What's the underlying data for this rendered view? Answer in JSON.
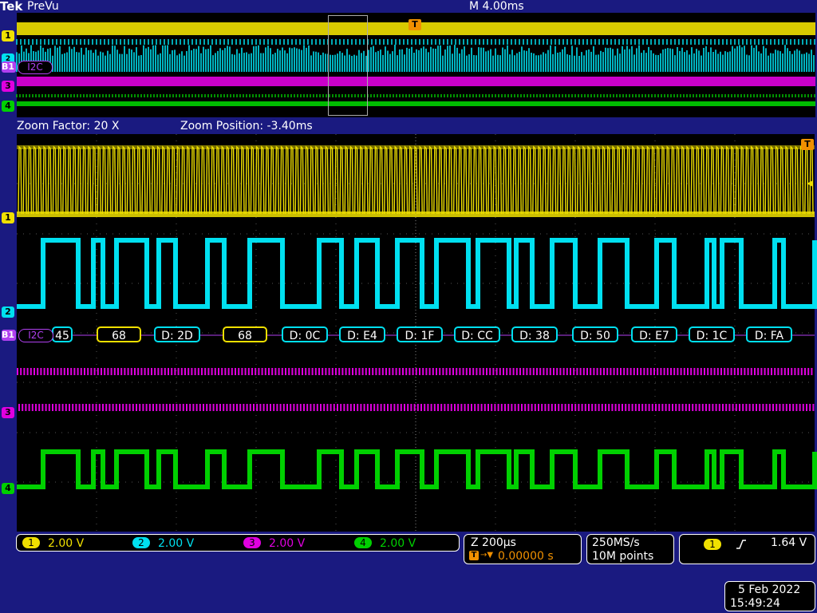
{
  "brand": "Tek",
  "mode": "PreVu",
  "timebase": "M 4.00ms",
  "zoom": {
    "factor_label": "Zoom Factor: 20 X",
    "position_label": "Zoom Position: -3.40ms"
  },
  "trigger_marker": "T",
  "bus": {
    "name": "I2C",
    "id": "B1",
    "packets": [
      {
        "text": "45",
        "kind": "data"
      },
      {
        "text": "68",
        "kind": "address"
      },
      {
        "text": "D: 2D",
        "kind": "data"
      },
      {
        "text": "68",
        "kind": "address"
      },
      {
        "text": "D: 0C",
        "kind": "data"
      },
      {
        "text": "D: E4",
        "kind": "data"
      },
      {
        "text": "D: 1F",
        "kind": "data"
      },
      {
        "text": "D: CC",
        "kind": "data"
      },
      {
        "text": "D: 38",
        "kind": "data"
      },
      {
        "text": "D: 50",
        "kind": "data"
      },
      {
        "text": "D: E7",
        "kind": "data"
      },
      {
        "text": "D: 1C",
        "kind": "data"
      },
      {
        "text": "D: FA",
        "kind": "data"
      }
    ]
  },
  "channels": [
    {
      "num": "1",
      "scale": "2.00 V",
      "color": "#f0e000"
    },
    {
      "num": "2",
      "scale": "2.00 V",
      "color": "#00e0f0"
    },
    {
      "num": "3",
      "scale": "2.00 V",
      "color": "#e000e0"
    },
    {
      "num": "4",
      "scale": "2.00 V",
      "color": "#00d000"
    }
  ],
  "horizontal": {
    "scale": "Z 200µs",
    "delay": "0.00000 s"
  },
  "acquisition": {
    "rate": "250MS/s",
    "record": "10M points"
  },
  "trigger": {
    "source": "1",
    "slope": "rising-edge-icon",
    "level": "1.64 V"
  },
  "datetime": {
    "date": "5 Feb  2022",
    "time": "15:49:24"
  }
}
